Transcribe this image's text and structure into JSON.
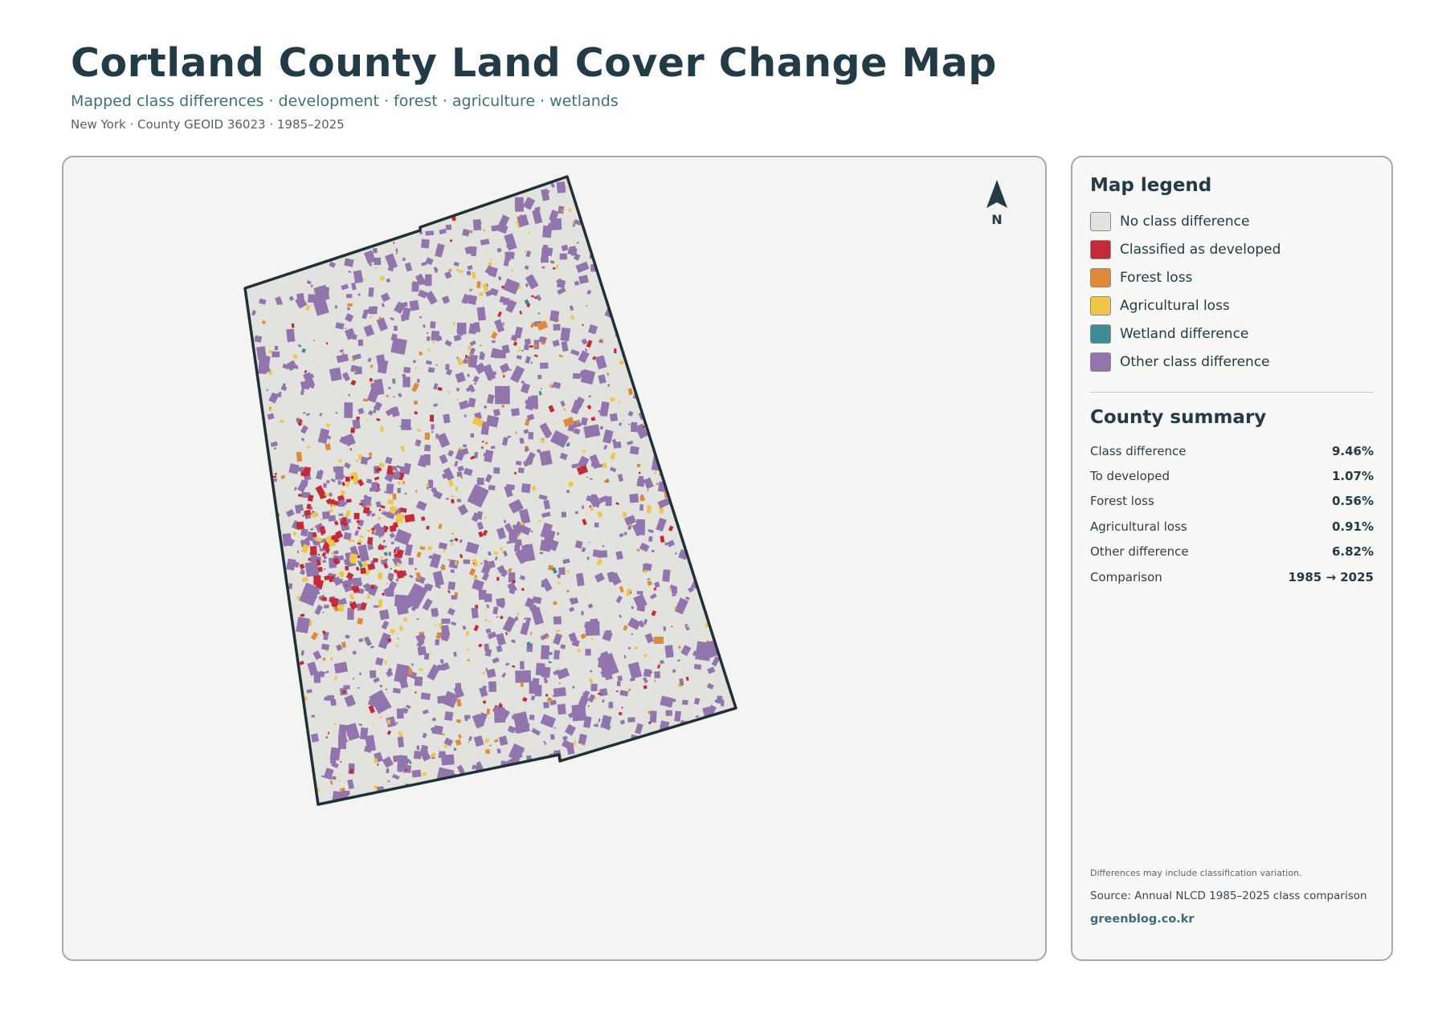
{
  "header": {
    "title": "Cortland County Land Cover Change Map",
    "subtitle": "Mapped class differences · development · forest · agriculture · wetlands",
    "meta": "New York · County GEOID 36023 · 1985–2025"
  },
  "map": {
    "north_label": "N",
    "boundary_color": "#1f3038",
    "base_fill": "#e2e3df",
    "icons": [
      "north-arrow-icon"
    ]
  },
  "legend": {
    "title": "Map legend",
    "items": [
      {
        "label": "No class difference",
        "color": "#e2e3df"
      },
      {
        "label": "Classified as developed",
        "color": "#c42a37"
      },
      {
        "label": "Forest loss",
        "color": "#de8a3a"
      },
      {
        "label": "Agricultural loss",
        "color": "#f0c548"
      },
      {
        "label": "Wetland difference",
        "color": "#3f8d94"
      },
      {
        "label": "Other class difference",
        "color": "#9375ae"
      }
    ]
  },
  "summary": {
    "title": "County summary",
    "rows": [
      {
        "label": "Class difference",
        "value": "9.46%"
      },
      {
        "label": "To developed",
        "value": "1.07%"
      },
      {
        "label": "Forest loss",
        "value": "0.56%"
      },
      {
        "label": "Agricultural loss",
        "value": "0.91%"
      },
      {
        "label": "Other difference",
        "value": "6.82%"
      },
      {
        "label": "Comparison",
        "value": "1985 → 2025"
      }
    ]
  },
  "footer": {
    "note": "Differences may include classification variation.",
    "source": "Source: Annual NLCD 1985–2025 class comparison",
    "site": "greenblog.co.kr"
  }
}
